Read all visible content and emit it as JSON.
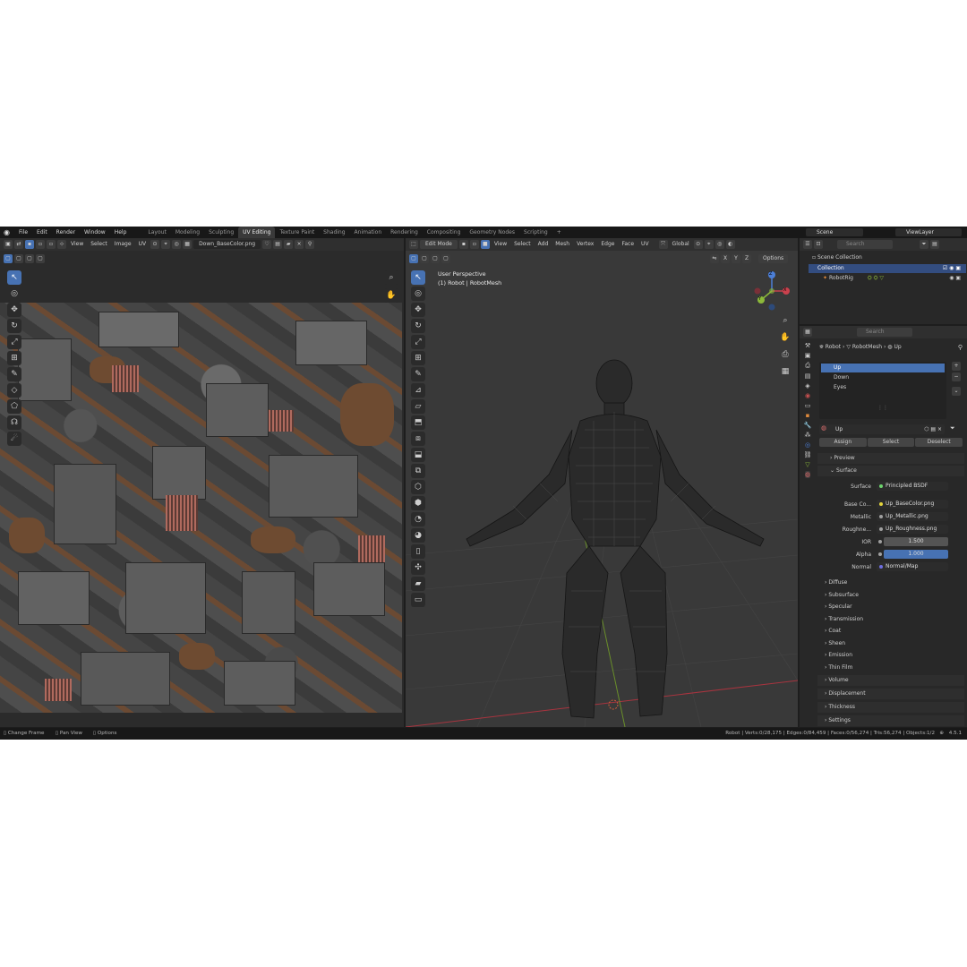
{
  "menu": [
    "File",
    "Edit",
    "Render",
    "Window",
    "Help"
  ],
  "workspaces": [
    "Layout",
    "Modeling",
    "Sculpting",
    "UV Editing",
    "Texture Paint",
    "Shading",
    "Animation",
    "Rendering",
    "Compositing",
    "Geometry Nodes",
    "Scripting"
  ],
  "active_workspace": "UV Editing",
  "scene_name": "Scene",
  "view_layer": "ViewLayer",
  "uv_editor": {
    "menus": [
      "View",
      "Select",
      "Image",
      "UV"
    ],
    "image_name": "Down_BaseColor.png"
  },
  "viewport": {
    "mode": "Edit Mode",
    "menus": [
      "View",
      "Select",
      "Add",
      "Mesh",
      "Vertex",
      "Edge",
      "Face",
      "UV"
    ],
    "transform": "Global",
    "options": "Options",
    "axis_labels": [
      "X",
      "Y",
      "Z"
    ],
    "perspective": "User Perspective",
    "object_info": "(1) Robot | RobotMesh",
    "gizmo": {
      "x": "X",
      "y": "Y",
      "z": "Z"
    }
  },
  "outliner": {
    "search_placeholder": "Search",
    "scene_collection": "Scene Collection",
    "collection": "Collection",
    "item": "RobotRig"
  },
  "properties": {
    "search_placeholder": "Search",
    "breadcrumb": [
      "Robot",
      "RobotMesh",
      "Up"
    ],
    "materials": [
      "Up",
      "Down",
      "Eyes"
    ],
    "active_material": "Up",
    "buttons": {
      "assign": "Assign",
      "select": "Select",
      "deselect": "Deselect"
    },
    "preview": "Preview",
    "surface_section": "Surface",
    "surface_label": "Surface",
    "surface_value": "Principled BSDF",
    "inputs": [
      {
        "label": "Base Co...",
        "value": "Up_BaseColor.png"
      },
      {
        "label": "Metallic",
        "value": "Up_Metallic.png"
      },
      {
        "label": "Roughne...",
        "value": "Up_Roughness.png"
      }
    ],
    "ior_label": "IOR",
    "ior_value": "1.500",
    "alpha_label": "Alpha",
    "alpha_value": "1.000",
    "normal_label": "Normal",
    "normal_value": "Normal/Map",
    "subsections": [
      "Diffuse",
      "Subsurface",
      "Specular",
      "Transmission",
      "Coat",
      "Sheen",
      "Emission",
      "Thin Film"
    ],
    "bottom_sections": [
      "Volume",
      "Displacement",
      "Thickness",
      "Settings"
    ]
  },
  "status": {
    "left": [
      "Change Frame",
      "Pan View",
      "Options"
    ],
    "stats": "Robot | Verts:0/28,175 | Edges:0/84,459 | Faces:0/56,274 | Tris:56,274 | Objects:1/2",
    "version": "4.5.1"
  },
  "colors": {
    "accent": "#4772b3",
    "background": "#1d1d1d",
    "editor": "#2b2b2b",
    "x_axis": "#c9414d",
    "y_axis": "#8cb93a",
    "z_axis": "#4c7fd8"
  }
}
